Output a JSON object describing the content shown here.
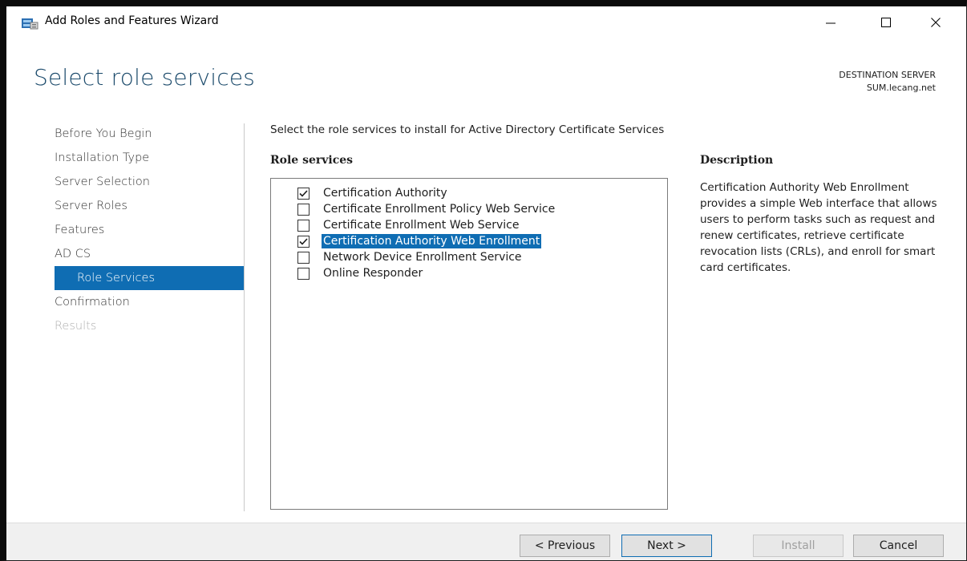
{
  "window": {
    "title": "Add Roles and Features Wizard",
    "minimize_glyph": "—",
    "maximize_glyph": "☐",
    "close_glyph": "✕"
  },
  "header": {
    "page_title": "Select role services",
    "destination_label": "DESTINATION SERVER",
    "destination_server": "SUM.lecang.net"
  },
  "nav": {
    "items": [
      {
        "label": "Before You Begin",
        "state": "normal"
      },
      {
        "label": "Installation Type",
        "state": "normal"
      },
      {
        "label": "Server Selection",
        "state": "normal"
      },
      {
        "label": "Server Roles",
        "state": "normal"
      },
      {
        "label": "Features",
        "state": "normal"
      },
      {
        "label": "AD CS",
        "state": "normal"
      },
      {
        "label": "Role Services",
        "state": "active"
      },
      {
        "label": "Confirmation",
        "state": "normal"
      },
      {
        "label": "Results",
        "state": "disabled"
      }
    ]
  },
  "content": {
    "instruction": "Select the role services to install for Active Directory Certificate Services",
    "role_services_heading": "Role services",
    "description_heading": "Description",
    "role_services": [
      {
        "label": "Certification Authority",
        "checked": true,
        "selected": false
      },
      {
        "label": "Certificate Enrollment Policy Web Service",
        "checked": false,
        "selected": false
      },
      {
        "label": "Certificate Enrollment Web Service",
        "checked": false,
        "selected": false
      },
      {
        "label": "Certification Authority Web Enrollment",
        "checked": true,
        "selected": true
      },
      {
        "label": "Network Device Enrollment Service",
        "checked": false,
        "selected": false
      },
      {
        "label": "Online Responder",
        "checked": false,
        "selected": false
      }
    ],
    "description": "Certification Authority Web Enrollment provides a simple Web interface that allows users to perform tasks such as request and renew certificates, retrieve certificate revocation lists (CRLs), and enroll for smart card certificates."
  },
  "footer": {
    "previous_label": "< Previous",
    "next_label": "Next >",
    "install_label": "Install",
    "cancel_label": "Cancel"
  },
  "colors": {
    "accent": "#0f6db3",
    "title": "#1b4a6b",
    "footer_bg": "#f0f0f0"
  }
}
